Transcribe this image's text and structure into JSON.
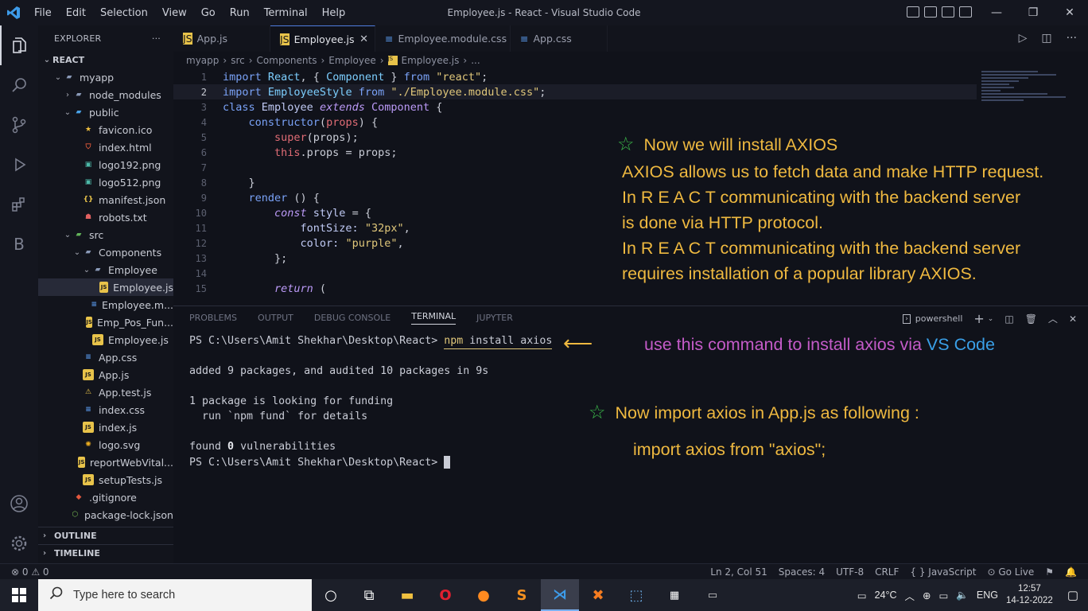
{
  "window": {
    "title": "Employee.js - React - Visual Studio Code",
    "menu": [
      "File",
      "Edit",
      "Selection",
      "View",
      "Go",
      "Run",
      "Terminal",
      "Help"
    ]
  },
  "explorer": {
    "header": "EXPLORER",
    "more": "···",
    "root": "REACT",
    "items": [
      {
        "label": "myapp",
        "indent": 1,
        "chev": "⌄",
        "icon": "folder"
      },
      {
        "label": "node_modules",
        "indent": 2,
        "chev": "›",
        "icon": "folder"
      },
      {
        "label": "public",
        "indent": 2,
        "chev": "⌄",
        "icon": "folderblue"
      },
      {
        "label": "favicon.ico",
        "indent": 3,
        "chev": "",
        "icon": "star"
      },
      {
        "label": "index.html",
        "indent": 3,
        "chev": "",
        "icon": "html"
      },
      {
        "label": "logo192.png",
        "indent": 3,
        "chev": "",
        "icon": "png"
      },
      {
        "label": "logo512.png",
        "indent": 3,
        "chev": "",
        "icon": "png"
      },
      {
        "label": "manifest.json",
        "indent": 3,
        "chev": "",
        "icon": "json"
      },
      {
        "label": "robots.txt",
        "indent": 3,
        "chev": "",
        "icon": "robot"
      },
      {
        "label": "src",
        "indent": 2,
        "chev": "⌄",
        "icon": "foldergreen"
      },
      {
        "label": "Components",
        "indent": 3,
        "chev": "⌄",
        "icon": "folder"
      },
      {
        "label": "Employee",
        "indent": 4,
        "chev": "⌄",
        "icon": "folder"
      },
      {
        "label": "Employee.js",
        "indent": 5,
        "chev": "",
        "icon": "js",
        "selected": true
      },
      {
        "label": "Employee.m...",
        "indent": 5,
        "chev": "",
        "icon": "css"
      },
      {
        "label": "Emp_Pos_Fun...",
        "indent": 4,
        "chev": "",
        "icon": "js"
      },
      {
        "label": "Employee.js",
        "indent": 4,
        "chev": "",
        "icon": "js"
      },
      {
        "label": "App.css",
        "indent": 3,
        "chev": "",
        "icon": "css"
      },
      {
        "label": "App.js",
        "indent": 3,
        "chev": "",
        "icon": "js"
      },
      {
        "label": "App.test.js",
        "indent": 3,
        "chev": "",
        "icon": "test"
      },
      {
        "label": "index.css",
        "indent": 3,
        "chev": "",
        "icon": "css"
      },
      {
        "label": "index.js",
        "indent": 3,
        "chev": "",
        "icon": "js"
      },
      {
        "label": "logo.svg",
        "indent": 3,
        "chev": "",
        "icon": "svg"
      },
      {
        "label": "reportWebVital...",
        "indent": 3,
        "chev": "",
        "icon": "js"
      },
      {
        "label": "setupTests.js",
        "indent": 3,
        "chev": "",
        "icon": "js"
      },
      {
        "label": ".gitignore",
        "indent": 2,
        "chev": "",
        "icon": "git"
      },
      {
        "label": "package-lock.json",
        "indent": 2,
        "chev": "",
        "icon": "lock"
      }
    ],
    "outline": "OUTLINE",
    "timeline": "TIMELINE"
  },
  "tabs": [
    {
      "label": "App.js",
      "icon": "js",
      "active": false
    },
    {
      "label": "Employee.js",
      "icon": "js",
      "active": true
    },
    {
      "label": "Employee.module.css",
      "icon": "css",
      "active": false
    },
    {
      "label": "App.css",
      "icon": "css",
      "active": false
    }
  ],
  "breadcrumb": [
    "myapp",
    "src",
    "Components",
    "Employee",
    "Employee.js",
    "..."
  ],
  "code_lines": [
    "1",
    "2",
    "3",
    "4",
    "5",
    "6",
    "7",
    "8",
    "9",
    "10",
    "11",
    "12",
    "13",
    "14",
    "15"
  ],
  "code": {
    "l1a": "import ",
    "l1b": "React",
    "l1c": ", { ",
    "l1d": "Component",
    "l1e": " } ",
    "l1f": "from ",
    "l1g": "\"react\"",
    "l1h": ";",
    "l2a": "import ",
    "l2b": "EmployeeStyle",
    "l2c": " from ",
    "l2d": "\"./Employee.module.css\"",
    "l2e": ";",
    "l3a": "class ",
    "l3b": "Employee ",
    "l3c": "extends ",
    "l3d": "Component",
    "l3e": " {",
    "l4a": "    constructor",
    "l4b": "(",
    "l4c": "props",
    "l4d": ") {",
    "l5a": "        super",
    "l5b": "(props);",
    "l6a": "        this",
    "l6b": ".props = props;",
    "l8": "    }",
    "l9a": "    render",
    "l9b": " () {",
    "l10a": "        const ",
    "l10b": "style",
    "l10c": " = {",
    "l11a": "            fontSize: ",
    "l11b": "\"32px\"",
    "l11c": ",",
    "l12a": "            color: ",
    "l12b": "\"purple\"",
    "l12c": ",",
    "l13": "        };",
    "l15a": "        return",
    "l15b": " ("
  },
  "annotations": {
    "axios_title": "Now we will install AXIOS",
    "axios_line1": "AXIOS allows us to fetch data and make HTTP request.",
    "axios_line2": "In R E A C T communicating with the backend server",
    "axios_line3": "is done via HTTP protocol.",
    "axios_line4": "In R E A C T  communicating with the backend server",
    "axios_line5": "requires installation of a popular library AXIOS.",
    "cmd_note_a": "use this command to install axios  via ",
    "cmd_note_b": "VS Code",
    "import_title": "Now import   axios  in  App.js  as following :",
    "import_line": "import  axios  from  \"axios\";",
    "star": "☆",
    "arrow": "⟵"
  },
  "panel": {
    "tabs": [
      "PROBLEMS",
      "OUTPUT",
      "DEBUG CONSOLE",
      "TERMINAL",
      "JUPYTER"
    ],
    "active_tab": "TERMINAL",
    "shell": "powershell"
  },
  "terminal": {
    "prompt": "PS C:\\Users\\Amit Shekhar\\Desktop\\React> ",
    "cmd_npm": "npm",
    "cmd_rest": " install axios",
    "out1": "added 9 packages, and audited 10 packages in 9s",
    "out2": "1 package is looking for funding",
    "out3": "  run `npm fund` for details",
    "out4a": "found ",
    "out4b": "0",
    "out4c": " vulnerabilities"
  },
  "status": {
    "problems": "⊗ 0 ⚠ 0",
    "position": "Ln 2, Col 51",
    "spaces": "Spaces: 4",
    "encoding": "UTF-8",
    "eol": "CRLF",
    "language": "{ } JavaScript",
    "golive": "⊙ Go Live"
  },
  "taskbar": {
    "search_placeholder": "Type here to search",
    "weather": "24°C",
    "lang": "ENG",
    "time": "12:57",
    "date": "14-12-2022"
  },
  "colors": {
    "accent": "#4f7de0",
    "annotation": "#efb940",
    "star": "#3bb84a",
    "purple_note": "#c45bc8",
    "vscode_blue": "#3aa0e8"
  }
}
